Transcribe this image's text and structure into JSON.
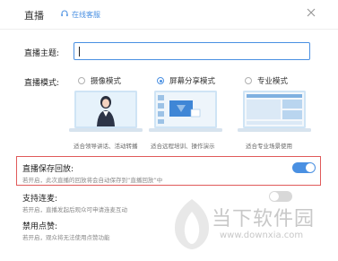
{
  "header": {
    "title": "直播",
    "service_icon": "headset-icon",
    "service_label": "在线客服",
    "close_icon": "close-icon"
  },
  "form": {
    "topic_label": "直播主题:",
    "topic_value": "",
    "mode_label": "直播模式:",
    "modes": [
      {
        "label": "摄像模式",
        "selected": false,
        "desc": "适合领导讲话、活动转播"
      },
      {
        "label": "屏幕分享模式",
        "selected": true,
        "desc": "适合远程培训、操作演示"
      },
      {
        "label": "专业模式",
        "selected": false,
        "desc": "适合专业场景使用"
      }
    ],
    "options": [
      {
        "label": "直播保存回放:",
        "desc": "若开启，此次直播的回放将会自动保存到“直播回放”中",
        "enabled": true
      },
      {
        "label": "支持连麦:",
        "desc": "若开启，直播发起后观众可申请连麦互动",
        "enabled": false
      },
      {
        "label": "禁用点赞:",
        "desc": "若开启，观众将无法使用点赞功能",
        "enabled": false
      }
    ]
  },
  "colors": {
    "accent": "#4a90e2",
    "highlight_border": "#e05a5a"
  },
  "watermark": {
    "text": "当下软件园",
    "url": "www.downxia.com"
  }
}
